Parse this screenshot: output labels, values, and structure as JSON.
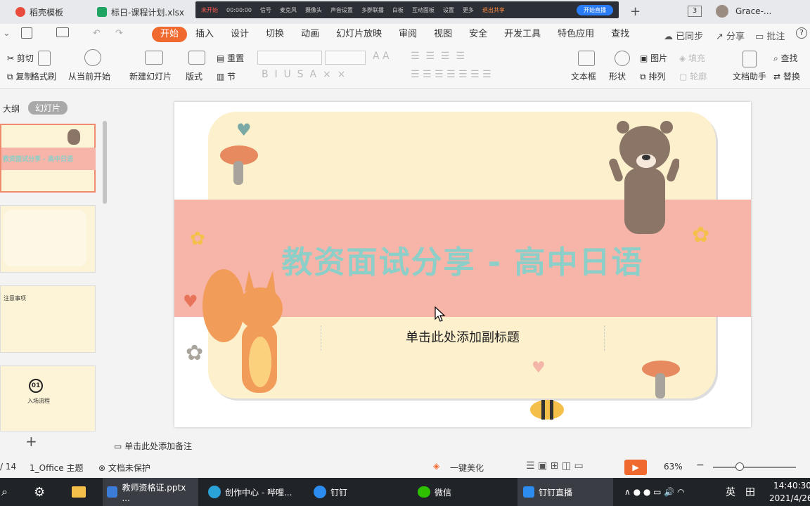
{
  "tabs": [
    {
      "label": "稻壳模板",
      "color": "#e94b3c"
    },
    {
      "label": "标日-课程计划.xlsx",
      "color": "#1fa463"
    }
  ],
  "live_bar": {
    "recording": "未开始",
    "time": "00:00:00",
    "items": [
      "信号",
      "麦克风",
      "摄像头",
      "声音设置",
      "多群联播",
      "白板",
      "互动面板",
      "设置",
      "更多"
    ],
    "share": "退出共享",
    "start": "开始直播"
  },
  "tab_counter": "3",
  "user": "Grace-...",
  "menu": [
    "开始",
    "插入",
    "设计",
    "切换",
    "动画",
    "幻灯片放映",
    "审阅",
    "视图",
    "安全",
    "开发工具",
    "特色应用",
    "查找"
  ],
  "menu_right": {
    "sync": "已同步",
    "share": "分享",
    "comment": "批注",
    "help": "?"
  },
  "ribbon": {
    "cut": "剪切",
    "format_painter": "格式刷",
    "copy": "复制",
    "play_from_current": "从当前开始",
    "new_slide": "新建幻灯片",
    "layout": "版式",
    "reset": "重置",
    "section": "节",
    "textbox": "文本框",
    "shape": "形状",
    "picture": "图片",
    "fill": "填充",
    "arrange": "排列",
    "outline": "轮廓",
    "doc_assistant": "文档助手",
    "find": "查找",
    "replace": "替换"
  },
  "panel_tabs": {
    "outline": "大纲",
    "slides": "幻灯片"
  },
  "thumbnails": [
    {
      "text": "教资面试分享 - 高中日语"
    },
    {
      "text": ""
    },
    {
      "text": "注意事项"
    },
    {
      "text": "入场流程",
      "number": "01"
    }
  ],
  "slide": {
    "title": "教资面试分享 - 高中日语",
    "subtitle_placeholder": "单击此处添加副标题",
    "title_color": "#8ccfc9",
    "band_color": "#f7b4a8",
    "bg_color": "#fdf0cc"
  },
  "add_slide": "+",
  "notes_placeholder": "单击此处添加备注",
  "status": {
    "page": "/ 14",
    "theme": "1_Office 主题",
    "protect": "文档未保护",
    "beautify": "一键美化",
    "zoom": "63%"
  },
  "taskbar": {
    "apps": [
      "教师资格证.pptx ...",
      "创作中心 - 哔哩...",
      "钉钉",
      "微信",
      "钉钉直播"
    ],
    "lang": "英",
    "time": "14:40:30",
    "date": "2021/4/26"
  }
}
